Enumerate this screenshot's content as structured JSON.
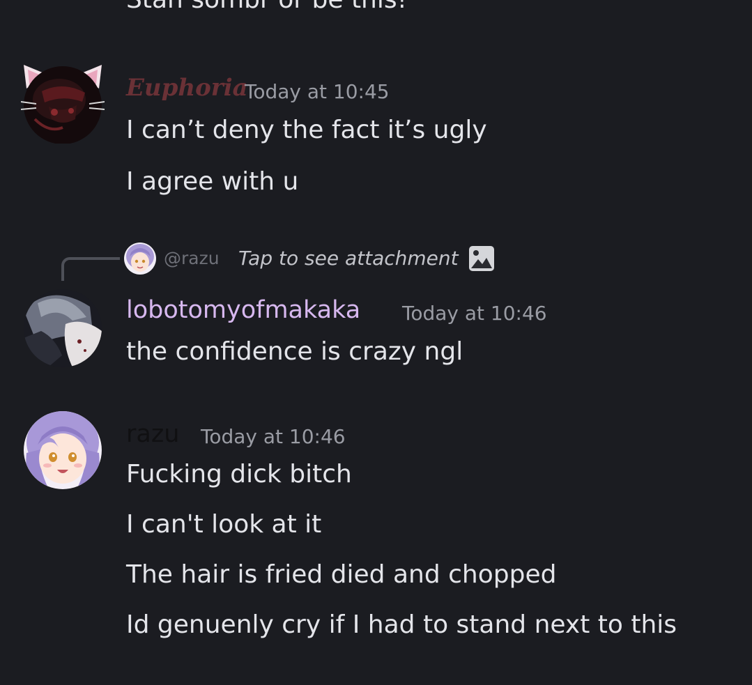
{
  "top_message": {
    "text": "Stan sombr or be this!"
  },
  "messages": [
    {
      "author": "Euphoria",
      "timestamp": "Today at 10:45",
      "lines": [
        "I can’t deny the fact it’s ugly",
        "I agree with u"
      ],
      "name_color": "#6a3136"
    },
    {
      "reply": {
        "mention": "@razu",
        "preview": "Tap to see attachment",
        "icon": "image-icon"
      },
      "author": "lobotomyofmakaka",
      "timestamp": "Today at 10:46",
      "lines": [
        "the confidence is crazy ngl"
      ],
      "name_color": "#d7b8ef"
    },
    {
      "author": "razu",
      "timestamp": "Today at 10:46",
      "lines": [
        "Fucking dick bitch",
        "I can't look at it",
        "The hair is fried died and chopped",
        "Id genuenly cry if I had to stand next to this"
      ],
      "name_color": "#101012"
    }
  ],
  "theme": {
    "background": "#1b1c21",
    "timestamp_color": "#9a9ca4"
  }
}
